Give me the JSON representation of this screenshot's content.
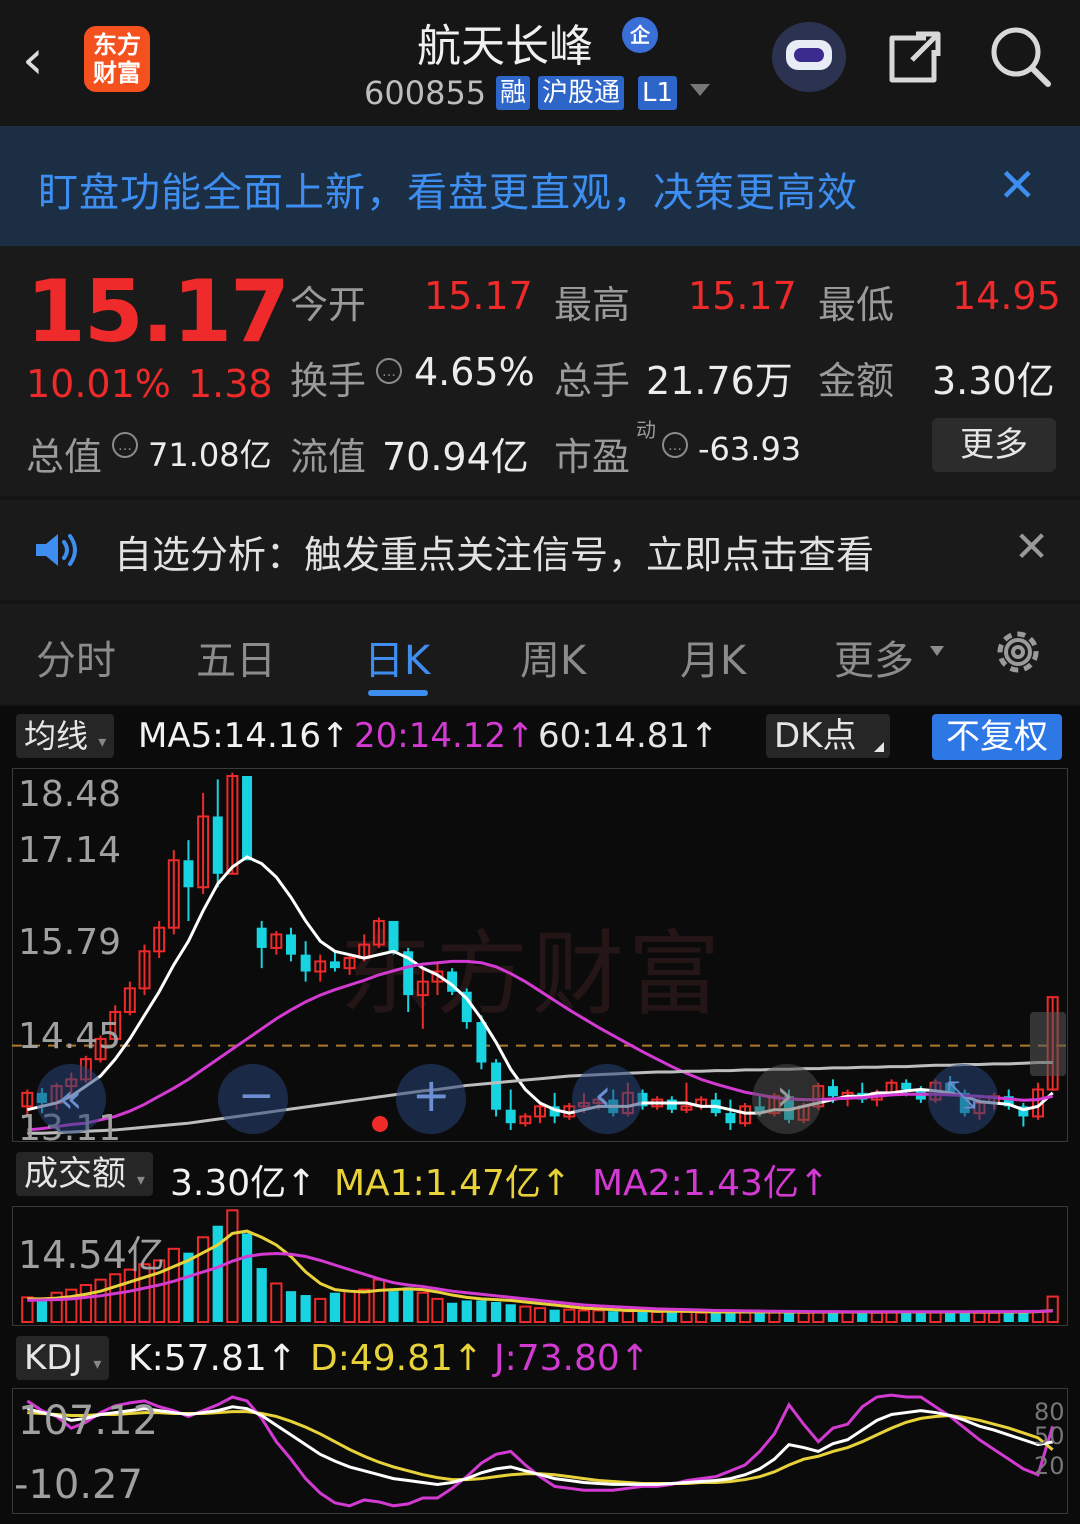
{
  "header": {
    "logo_text": "东方财富",
    "stock_name": "航天长峰",
    "name_badge": "企",
    "stock_code": "600855",
    "tags": [
      "融",
      "沪股通",
      "L1"
    ]
  },
  "banner": {
    "text": "盯盘功能全面上新，看盘更直观，决策更高效",
    "close": "✕"
  },
  "quote": {
    "price": "15.17",
    "change_pct": "10.01%",
    "change": "1.38",
    "open_label": "今开",
    "open": "15.17",
    "high_label": "最高",
    "high": "15.17",
    "low_label": "最低",
    "low": "14.95",
    "turnover_label": "换手",
    "turnover": "4.65%",
    "volume_label": "总手",
    "volume": "21.76万",
    "amount_label": "金额",
    "amount": "3.30亿",
    "total_cap_label": "总值",
    "total_cap": "71.08亿",
    "float_cap_label": "流值",
    "float_cap": "70.94亿",
    "pe_label": "市盈",
    "pe_sup": "动",
    "pe": "-63.93",
    "more_button": "更多"
  },
  "alert": {
    "text": "自选分析：触发重点关注信号，立即点击查看",
    "close": "✕"
  },
  "tabs": [
    "分时",
    "五日",
    "日K",
    "周K",
    "月K",
    "更多"
  ],
  "active_tab": "日K",
  "ma_row": {
    "selector": "均线",
    "ma5": "MA5:14.16↑",
    "ma20": "20:14.12↑",
    "ma60": "60:14.81↑",
    "dk_button": "DK点",
    "adjust_button": "不复权"
  },
  "amount_row": {
    "selector": "成交额",
    "amount": "3.30亿↑",
    "ma1": "MA1:1.47亿↑",
    "ma2": "MA2:1.43亿↑"
  },
  "kdj_row": {
    "selector": "KDJ",
    "k": "K:57.81↑",
    "d": "D:49.81↑",
    "j": "J:73.80↑"
  },
  "colors": {
    "up": "#ee2a2a",
    "down": "#18d3e0",
    "ma5": "#ffffff",
    "ma20": "#d23ad2",
    "ma60": "#bdbdbd",
    "accent": "#3d8ef0",
    "yellow": "#e8d23a"
  },
  "chart_data": [
    {
      "type": "candlestick",
      "title": "日K",
      "y_ticks": [
        "18.48",
        "17.14",
        "15.79",
        "14.45",
        "13.11"
      ],
      "ylim": [
        13.11,
        18.48
      ],
      "reference_line": 14.45,
      "watermark": "东方财富",
      "candles": [
        [
          13.55,
          13.8,
          13.4,
          13.75
        ],
        [
          13.75,
          13.82,
          13.45,
          13.6
        ],
        [
          13.6,
          13.9,
          13.5,
          13.85
        ],
        [
          13.85,
          14.05,
          13.7,
          13.95
        ],
        [
          13.95,
          14.3,
          13.9,
          14.25
        ],
        [
          14.25,
          14.6,
          14.2,
          14.55
        ],
        [
          14.55,
          15.05,
          14.5,
          14.95
        ],
        [
          14.95,
          15.4,
          14.9,
          15.3
        ],
        [
          15.3,
          15.95,
          15.2,
          15.85
        ],
        [
          15.85,
          16.3,
          15.75,
          16.2
        ],
        [
          16.2,
          17.35,
          16.1,
          17.2
        ],
        [
          17.2,
          17.5,
          16.3,
          16.8
        ],
        [
          16.8,
          18.2,
          16.7,
          17.85
        ],
        [
          17.85,
          18.4,
          16.8,
          17.0
        ],
        [
          17.0,
          18.5,
          17.0,
          18.45
        ],
        [
          18.45,
          18.45,
          17.2,
          17.2
        ],
        [
          16.2,
          16.3,
          15.6,
          15.9
        ],
        [
          15.9,
          16.15,
          15.8,
          16.1
        ],
        [
          16.1,
          16.2,
          15.7,
          15.8
        ],
        [
          15.8,
          16.0,
          15.4,
          15.55
        ],
        [
          15.55,
          15.8,
          15.4,
          15.7
        ],
        [
          15.7,
          15.85,
          15.55,
          15.6
        ],
        [
          15.6,
          15.8,
          15.5,
          15.75
        ],
        [
          15.75,
          16.1,
          15.7,
          15.95
        ],
        [
          15.95,
          16.35,
          15.9,
          16.3
        ],
        [
          16.3,
          16.3,
          15.8,
          15.85
        ],
        [
          15.85,
          15.9,
          14.95,
          15.2
        ],
        [
          15.2,
          15.6,
          14.7,
          15.4
        ],
        [
          15.4,
          15.7,
          15.2,
          15.55
        ],
        [
          15.55,
          15.6,
          15.2,
          15.25
        ],
        [
          15.25,
          15.3,
          14.7,
          14.8
        ],
        [
          14.8,
          14.9,
          14.1,
          14.2
        ],
        [
          14.2,
          14.25,
          13.4,
          13.5
        ],
        [
          13.5,
          13.8,
          13.2,
          13.3
        ],
        [
          13.3,
          13.45,
          13.25,
          13.4
        ],
        [
          13.4,
          13.6,
          13.3,
          13.55
        ],
        [
          13.55,
          13.75,
          13.3,
          13.4
        ],
        [
          13.4,
          13.6,
          13.35,
          13.55
        ],
        [
          13.55,
          13.75,
          13.45,
          13.6
        ],
        [
          13.6,
          13.7,
          13.5,
          13.65
        ],
        [
          13.65,
          13.8,
          13.4,
          13.45
        ],
        [
          13.45,
          13.9,
          13.4,
          13.75
        ],
        [
          13.75,
          13.8,
          13.5,
          13.55
        ],
        [
          13.55,
          13.7,
          13.5,
          13.65
        ],
        [
          13.65,
          13.7,
          13.45,
          13.5
        ],
        [
          13.5,
          13.9,
          13.45,
          13.55
        ],
        [
          13.55,
          13.7,
          13.5,
          13.65
        ],
        [
          13.65,
          13.75,
          13.4,
          13.45
        ],
        [
          13.45,
          13.65,
          13.2,
          13.3
        ],
        [
          13.3,
          13.6,
          13.25,
          13.55
        ],
        [
          13.55,
          13.7,
          13.4,
          13.45
        ],
        [
          13.45,
          13.75,
          13.4,
          13.7
        ],
        [
          13.7,
          13.8,
          13.3,
          13.35
        ],
        [
          13.35,
          13.6,
          13.3,
          13.55
        ],
        [
          13.55,
          13.9,
          13.5,
          13.85
        ],
        [
          13.85,
          13.95,
          13.6,
          13.7
        ],
        [
          13.7,
          13.8,
          13.55,
          13.75
        ],
        [
          13.75,
          13.9,
          13.6,
          13.65
        ],
        [
          13.65,
          13.8,
          13.55,
          13.75
        ],
        [
          13.75,
          13.95,
          13.7,
          13.9
        ],
        [
          13.9,
          13.95,
          13.7,
          13.8
        ],
        [
          13.8,
          13.85,
          13.6,
          13.65
        ],
        [
          13.65,
          13.95,
          13.6,
          13.9
        ],
        [
          13.9,
          14.0,
          13.7,
          13.75
        ],
        [
          13.75,
          13.8,
          13.4,
          13.45
        ],
        [
          13.45,
          13.7,
          13.35,
          13.6
        ],
        [
          13.6,
          13.75,
          13.5,
          13.7
        ],
        [
          13.7,
          13.8,
          13.5,
          13.55
        ],
        [
          13.55,
          13.6,
          13.25,
          13.4
        ],
        [
          13.4,
          13.9,
          13.35,
          13.8
        ],
        [
          13.8,
          15.17,
          13.78,
          15.17
        ]
      ],
      "series": [
        {
          "name": "MA5",
          "values": [
            13.5,
            13.55,
            13.6,
            13.7,
            13.85,
            14.0,
            14.25,
            14.55,
            14.9,
            15.25,
            15.65,
            16.0,
            16.45,
            16.85,
            17.1,
            17.25,
            17.15,
            16.95,
            16.65,
            16.3,
            16.0,
            15.85,
            15.8,
            15.75,
            15.8,
            15.85,
            15.75,
            15.6,
            15.5,
            15.35,
            15.15,
            14.85,
            14.5,
            14.1,
            13.8,
            13.6,
            13.5,
            13.45,
            13.5,
            13.55,
            13.55,
            13.55,
            13.6,
            13.6,
            13.6,
            13.6,
            13.55,
            13.55,
            13.5,
            13.45,
            13.45,
            13.5,
            13.5,
            13.55,
            13.6,
            13.65,
            13.7,
            13.7,
            13.75,
            13.75,
            13.78,
            13.8,
            13.78,
            13.75,
            13.7,
            13.62,
            13.6,
            13.58,
            13.5,
            13.55,
            13.75
          ]
        },
        {
          "name": "MA20",
          "values": [
            13.2,
            13.22,
            13.25,
            13.28,
            13.3,
            13.35,
            13.4,
            13.48,
            13.58,
            13.7,
            13.82,
            13.95,
            14.1,
            14.25,
            14.4,
            14.55,
            14.7,
            14.85,
            14.98,
            15.1,
            15.2,
            15.28,
            15.35,
            15.42,
            15.5,
            15.56,
            15.62,
            15.66,
            15.68,
            15.7,
            15.7,
            15.68,
            15.62,
            15.52,
            15.4,
            15.26,
            15.12,
            14.98,
            14.85,
            14.72,
            14.6,
            14.48,
            14.36,
            14.25,
            14.14,
            14.04,
            13.95,
            13.88,
            13.82,
            13.76,
            13.72,
            13.68,
            13.66,
            13.65,
            13.65,
            13.66,
            13.67,
            13.68,
            13.7,
            13.72,
            13.73,
            13.73,
            13.73,
            13.72,
            13.71,
            13.7,
            13.68,
            13.66,
            13.64,
            13.65,
            13.7
          ]
        },
        {
          "name": "MA60",
          "values": [
            13.15,
            13.15,
            13.16,
            13.17,
            13.18,
            13.19,
            13.2,
            13.22,
            13.24,
            13.26,
            13.28,
            13.3,
            13.33,
            13.36,
            13.39,
            13.42,
            13.45,
            13.48,
            13.51,
            13.54,
            13.57,
            13.6,
            13.63,
            13.66,
            13.69,
            13.72,
            13.75,
            13.78,
            13.8,
            13.83,
            13.86,
            13.88,
            13.9,
            13.92,
            13.94,
            13.96,
            13.98,
            14.0,
            14.01,
            14.02,
            14.03,
            14.04,
            14.05,
            14.06,
            14.06,
            14.07,
            14.07,
            14.08,
            14.08,
            14.09,
            14.09,
            14.1,
            14.1,
            14.11,
            14.11,
            14.12,
            14.12,
            14.13,
            14.13,
            14.14,
            14.14,
            14.15,
            14.16,
            14.16,
            14.17,
            14.17,
            14.18,
            14.18,
            14.19,
            14.2,
            14.2
          ]
        }
      ]
    },
    {
      "type": "bar",
      "title": "成交额",
      "y_ticks": [
        "14.54亿"
      ],
      "ylim": [
        0,
        14.54
      ],
      "unit": "亿",
      "values": [
        3.2,
        2.9,
        3.8,
        4.2,
        4.8,
        5.5,
        6.2,
        6.8,
        7.5,
        8.0,
        9.5,
        9.0,
        11.0,
        12.5,
        14.5,
        11.5,
        7.0,
        5.0,
        4.0,
        3.5,
        3.0,
        3.8,
        4.0,
        4.2,
        5.5,
        4.0,
        4.5,
        3.8,
        3.0,
        2.5,
        2.8,
        2.8,
        2.6,
        2.3,
        2.0,
        1.8,
        1.6,
        1.6,
        1.5,
        1.5,
        1.4,
        1.4,
        1.3,
        1.3,
        1.4,
        1.3,
        1.2,
        1.2,
        1.2,
        1.3,
        1.2,
        1.3,
        1.2,
        1.2,
        1.3,
        1.2,
        1.3,
        1.2,
        1.2,
        1.3,
        1.3,
        1.2,
        1.3,
        1.2,
        1.3,
        1.2,
        1.2,
        1.2,
        1.3,
        1.4,
        3.3
      ],
      "series": [
        {
          "name": "MA1",
          "values": [
            3.0,
            3.0,
            3.1,
            3.3,
            3.6,
            4.0,
            4.6,
            5.2,
            5.8,
            6.4,
            7.2,
            8.0,
            9.0,
            10.0,
            11.5,
            11.8,
            11.0,
            10.0,
            8.5,
            6.5,
            5.0,
            4.2,
            4.0,
            3.9,
            4.1,
            4.2,
            4.3,
            4.2,
            3.9,
            3.5,
            3.2,
            3.0,
            2.9,
            2.8,
            2.6,
            2.4,
            2.2,
            2.0,
            1.8,
            1.7,
            1.6,
            1.5,
            1.5,
            1.4,
            1.4,
            1.4,
            1.35,
            1.3,
            1.3,
            1.3,
            1.3,
            1.3,
            1.3,
            1.3,
            1.3,
            1.3,
            1.3,
            1.3,
            1.3,
            1.3,
            1.3,
            1.3,
            1.3,
            1.3,
            1.3,
            1.3,
            1.3,
            1.3,
            1.3,
            1.35,
            1.47
          ]
        },
        {
          "name": "MA2",
          "values": [
            2.8,
            2.85,
            2.9,
            3.0,
            3.2,
            3.4,
            3.7,
            4.0,
            4.4,
            4.8,
            5.3,
            5.9,
            6.5,
            7.1,
            7.9,
            8.5,
            8.8,
            8.9,
            8.8,
            8.5,
            8.0,
            7.4,
            6.8,
            6.2,
            5.6,
            5.1,
            4.8,
            4.6,
            4.3,
            4.0,
            3.8,
            3.6,
            3.4,
            3.2,
            3.0,
            2.8,
            2.6,
            2.4,
            2.2,
            2.1,
            2.0,
            1.9,
            1.8,
            1.7,
            1.65,
            1.6,
            1.55,
            1.5,
            1.48,
            1.45,
            1.42,
            1.4,
            1.38,
            1.36,
            1.35,
            1.34,
            1.33,
            1.33,
            1.33,
            1.33,
            1.33,
            1.33,
            1.33,
            1.33,
            1.33,
            1.34,
            1.34,
            1.35,
            1.36,
            1.38,
            1.43
          ]
        }
      ]
    },
    {
      "type": "line",
      "title": "KDJ",
      "y_ticks": [
        "107.12",
        "-10.27"
      ],
      "right_ticks": [
        "80",
        "50",
        "20"
      ],
      "ylim": [
        -10.27,
        107.12
      ],
      "series": [
        {
          "name": "K",
          "values": [
            92,
            88,
            85,
            80,
            82,
            86,
            88,
            90,
            92,
            90,
            88,
            86,
            88,
            90,
            94,
            92,
            85,
            75,
            65,
            55,
            45,
            38,
            32,
            28,
            24,
            20,
            18,
            16,
            14,
            16,
            20,
            26,
            30,
            32,
            28,
            24,
            20,
            18,
            16,
            15,
            14,
            14,
            14,
            14,
            15,
            16,
            17,
            18,
            20,
            24,
            30,
            40,
            55,
            52,
            48,
            56,
            60,
            70,
            80,
            86,
            88,
            90,
            88,
            85,
            80,
            74,
            70,
            65,
            60,
            55,
            57.81
          ]
        },
        {
          "name": "D",
          "values": [
            88,
            87,
            86,
            85,
            85,
            86,
            86,
            87,
            88,
            88,
            87,
            87,
            87,
            88,
            89,
            89,
            87,
            84,
            79,
            73,
            66,
            58,
            50,
            43,
            37,
            32,
            28,
            24,
            21,
            19,
            19,
            20,
            22,
            24,
            25,
            25,
            24,
            22,
            20,
            18,
            17,
            16,
            15,
            15,
            15,
            15,
            16,
            16,
            17,
            19,
            22,
            27,
            34,
            40,
            43,
            48,
            52,
            58,
            65,
            72,
            78,
            82,
            84,
            85,
            83,
            80,
            76,
            72,
            67,
            62,
            49.81
          ]
        },
        {
          "name": "J",
          "values": [
            100,
            90,
            84,
            72,
            78,
            88,
            95,
            98,
            100,
            94,
            90,
            84,
            90,
            96,
            104,
            100,
            82,
            58,
            40,
            20,
            5,
            -5,
            -8,
            -2,
            -4,
            -8,
            -6,
            0,
            0,
            10,
            22,
            36,
            45,
            48,
            34,
            22,
            12,
            10,
            8,
            8,
            8,
            10,
            12,
            12,
            14,
            18,
            20,
            22,
            28,
            34,
            48,
            66,
            96,
            76,
            58,
            72,
            76,
            94,
            104,
            106,
            104,
            104,
            94,
            84,
            72,
            60,
            50,
            40,
            30,
            24,
            73.8
          ]
        }
      ]
    }
  ]
}
